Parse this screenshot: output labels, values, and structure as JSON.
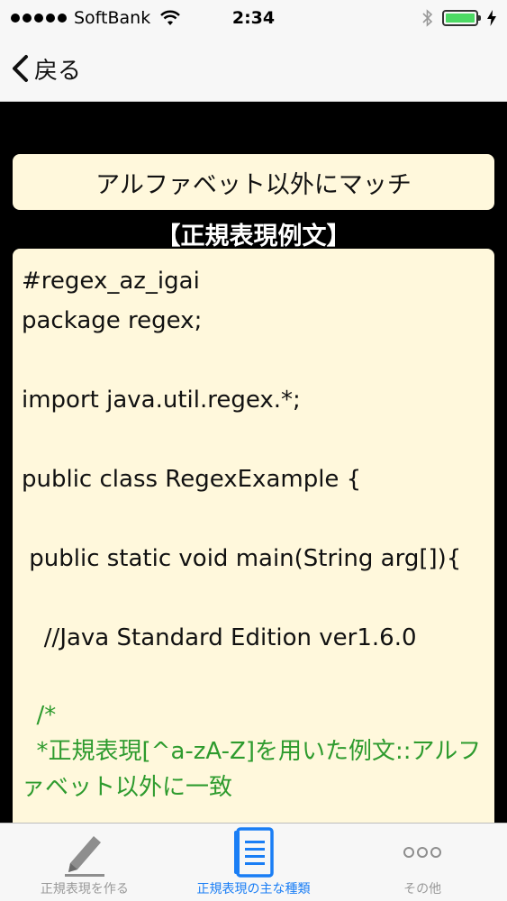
{
  "status_bar": {
    "carrier": "SoftBank",
    "time": "2:34",
    "battery_level": 1.0
  },
  "nav": {
    "back_label": "戻る"
  },
  "content": {
    "title": "アルファベット以外にマッチ",
    "section_label": "【正規表現例文】",
    "code_lines": [
      "#regex_az_igai",
      "package regex;",
      "",
      "import java.util.regex.*;",
      "",
      "public class RegexExample {",
      "",
      " public static void main(String arg[]){",
      "",
      "   //Java Standard Edition ver1.6.0",
      ""
    ],
    "comment_lines": [
      "  /*",
      "  *正規表現[^a-zA-Z]を用いた例文::アルファベット以外に一致"
    ]
  },
  "tab_bar": {
    "tabs": [
      {
        "label": "正規表現を作る",
        "icon": "pencil-icon"
      },
      {
        "label": "正規表現の主な種類",
        "icon": "document-icon"
      },
      {
        "label": "その他",
        "icon": "more-icon"
      }
    ],
    "active_index": 1
  },
  "colors": {
    "accent": "#1a7ef5",
    "card_bg": "#fff8dc",
    "comment": "#2e9b2e",
    "battery": "#4cd964"
  }
}
